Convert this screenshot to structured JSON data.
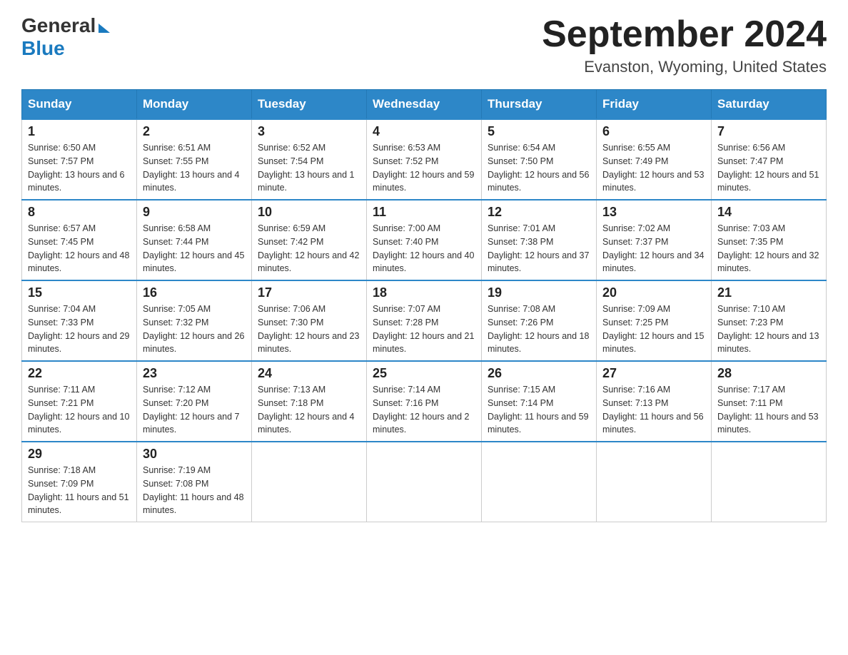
{
  "header": {
    "logo_general": "General",
    "logo_blue": "Blue",
    "title": "September 2024",
    "subtitle": "Evanston, Wyoming, United States"
  },
  "days_of_week": [
    "Sunday",
    "Monday",
    "Tuesday",
    "Wednesday",
    "Thursday",
    "Friday",
    "Saturday"
  ],
  "weeks": [
    [
      {
        "day": "1",
        "sunrise": "6:50 AM",
        "sunset": "7:57 PM",
        "daylight": "13 hours and 6 minutes."
      },
      {
        "day": "2",
        "sunrise": "6:51 AM",
        "sunset": "7:55 PM",
        "daylight": "13 hours and 4 minutes."
      },
      {
        "day": "3",
        "sunrise": "6:52 AM",
        "sunset": "7:54 PM",
        "daylight": "13 hours and 1 minute."
      },
      {
        "day": "4",
        "sunrise": "6:53 AM",
        "sunset": "7:52 PM",
        "daylight": "12 hours and 59 minutes."
      },
      {
        "day": "5",
        "sunrise": "6:54 AM",
        "sunset": "7:50 PM",
        "daylight": "12 hours and 56 minutes."
      },
      {
        "day": "6",
        "sunrise": "6:55 AM",
        "sunset": "7:49 PM",
        "daylight": "12 hours and 53 minutes."
      },
      {
        "day": "7",
        "sunrise": "6:56 AM",
        "sunset": "7:47 PM",
        "daylight": "12 hours and 51 minutes."
      }
    ],
    [
      {
        "day": "8",
        "sunrise": "6:57 AM",
        "sunset": "7:45 PM",
        "daylight": "12 hours and 48 minutes."
      },
      {
        "day": "9",
        "sunrise": "6:58 AM",
        "sunset": "7:44 PM",
        "daylight": "12 hours and 45 minutes."
      },
      {
        "day": "10",
        "sunrise": "6:59 AM",
        "sunset": "7:42 PM",
        "daylight": "12 hours and 42 minutes."
      },
      {
        "day": "11",
        "sunrise": "7:00 AM",
        "sunset": "7:40 PM",
        "daylight": "12 hours and 40 minutes."
      },
      {
        "day": "12",
        "sunrise": "7:01 AM",
        "sunset": "7:38 PM",
        "daylight": "12 hours and 37 minutes."
      },
      {
        "day": "13",
        "sunrise": "7:02 AM",
        "sunset": "7:37 PM",
        "daylight": "12 hours and 34 minutes."
      },
      {
        "day": "14",
        "sunrise": "7:03 AM",
        "sunset": "7:35 PM",
        "daylight": "12 hours and 32 minutes."
      }
    ],
    [
      {
        "day": "15",
        "sunrise": "7:04 AM",
        "sunset": "7:33 PM",
        "daylight": "12 hours and 29 minutes."
      },
      {
        "day": "16",
        "sunrise": "7:05 AM",
        "sunset": "7:32 PM",
        "daylight": "12 hours and 26 minutes."
      },
      {
        "day": "17",
        "sunrise": "7:06 AM",
        "sunset": "7:30 PM",
        "daylight": "12 hours and 23 minutes."
      },
      {
        "day": "18",
        "sunrise": "7:07 AM",
        "sunset": "7:28 PM",
        "daylight": "12 hours and 21 minutes."
      },
      {
        "day": "19",
        "sunrise": "7:08 AM",
        "sunset": "7:26 PM",
        "daylight": "12 hours and 18 minutes."
      },
      {
        "day": "20",
        "sunrise": "7:09 AM",
        "sunset": "7:25 PM",
        "daylight": "12 hours and 15 minutes."
      },
      {
        "day": "21",
        "sunrise": "7:10 AM",
        "sunset": "7:23 PM",
        "daylight": "12 hours and 13 minutes."
      }
    ],
    [
      {
        "day": "22",
        "sunrise": "7:11 AM",
        "sunset": "7:21 PM",
        "daylight": "12 hours and 10 minutes."
      },
      {
        "day": "23",
        "sunrise": "7:12 AM",
        "sunset": "7:20 PM",
        "daylight": "12 hours and 7 minutes."
      },
      {
        "day": "24",
        "sunrise": "7:13 AM",
        "sunset": "7:18 PM",
        "daylight": "12 hours and 4 minutes."
      },
      {
        "day": "25",
        "sunrise": "7:14 AM",
        "sunset": "7:16 PM",
        "daylight": "12 hours and 2 minutes."
      },
      {
        "day": "26",
        "sunrise": "7:15 AM",
        "sunset": "7:14 PM",
        "daylight": "11 hours and 59 minutes."
      },
      {
        "day": "27",
        "sunrise": "7:16 AM",
        "sunset": "7:13 PM",
        "daylight": "11 hours and 56 minutes."
      },
      {
        "day": "28",
        "sunrise": "7:17 AM",
        "sunset": "7:11 PM",
        "daylight": "11 hours and 53 minutes."
      }
    ],
    [
      {
        "day": "29",
        "sunrise": "7:18 AM",
        "sunset": "7:09 PM",
        "daylight": "11 hours and 51 minutes."
      },
      {
        "day": "30",
        "sunrise": "7:19 AM",
        "sunset": "7:08 PM",
        "daylight": "11 hours and 48 minutes."
      },
      null,
      null,
      null,
      null,
      null
    ]
  ]
}
